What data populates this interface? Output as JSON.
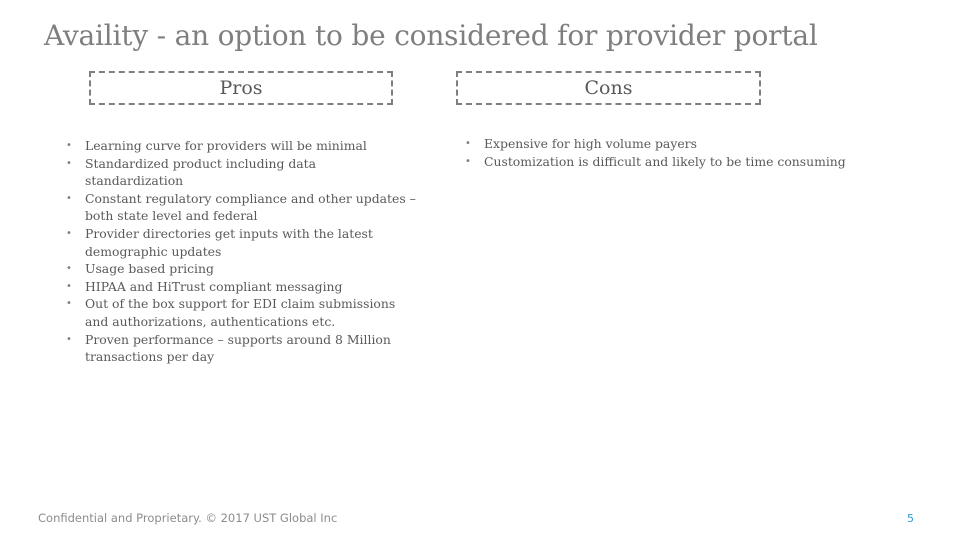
{
  "slide": {
    "title": "Availity - an option to be considered for provider portal",
    "page_number": "5",
    "footer": "Confidential and Proprietary. © 2017 UST Global Inc"
  },
  "pros": {
    "header": "Pros",
    "bullet_glyph": "•",
    "items": [
      "Learning curve for providers will be minimal",
      "Standardized product including data standardization",
      "Constant regulatory compliance and other updates – both state level and federal",
      "Provider directories get inputs with the latest demographic updates",
      "Usage based pricing",
      "HIPAA and HiTrust compliant messaging",
      "Out of the box support for EDI claim submissions and authorizations, authentications etc.",
      "Proven performance – supports around 8 Million transactions per day"
    ]
  },
  "cons": {
    "header": "Cons",
    "bullet_glyph": "•",
    "items": [
      "Expensive for high volume payers",
      "Customization is difficult and likely to be time consuming"
    ]
  },
  "colors": {
    "title": "#7f7f7f",
    "text": "#595959",
    "border": "#7f7f7f",
    "page_number": "#2e9ad6"
  }
}
